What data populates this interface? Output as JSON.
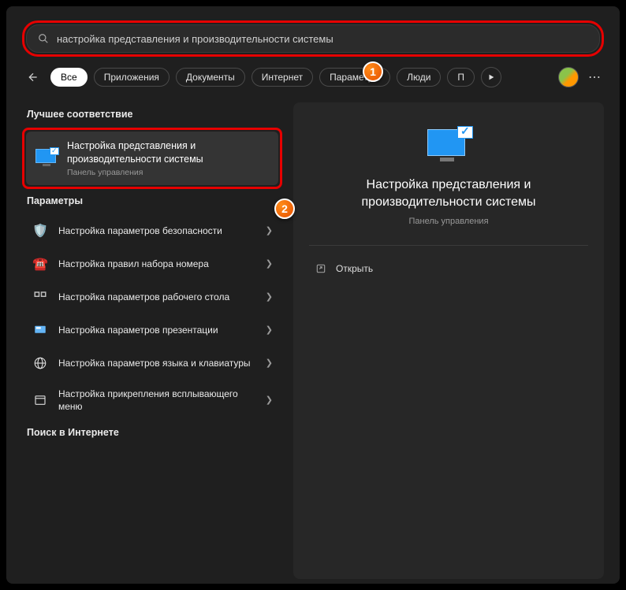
{
  "search": {
    "query": "настройка представления и производительности системы"
  },
  "filters": {
    "all": "Все",
    "apps": "Приложения",
    "docs": "Документы",
    "internet": "Интернет",
    "settings": "Параметры",
    "people": "Люди",
    "more": "П"
  },
  "sections": {
    "best_match": "Лучшее соответствие",
    "settings": "Параметры",
    "web": "Поиск в Интернете"
  },
  "best_match": {
    "title": "Настройка представления и производительности системы",
    "subtitle": "Панель управления"
  },
  "results": [
    {
      "title": "Настройка параметров безопасности"
    },
    {
      "title": "Настройка правил набора номера"
    },
    {
      "title": "Настройка параметров рабочего стола"
    },
    {
      "title": "Настройка параметров презентации"
    },
    {
      "title": "Настройка параметров языка и клавиатуры"
    },
    {
      "title": "Настройка прикрепления всплывающего меню"
    }
  ],
  "detail": {
    "title": "Настройка представления и производительности системы",
    "subtitle": "Панель управления",
    "open": "Открыть"
  },
  "badges": {
    "one": "1",
    "two": "2"
  }
}
